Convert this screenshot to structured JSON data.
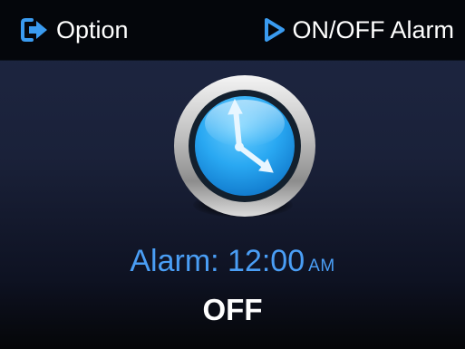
{
  "topbar": {
    "option_label": "Option",
    "option_icon": "exit-arrow-icon",
    "alarm_toggle_label": "ON/OFF Alarm",
    "alarm_toggle_icon": "play-triangle-icon",
    "icon_color": "#3a9bf0"
  },
  "clock": {
    "icon": "clock-icon",
    "face_color": "#29a8f2"
  },
  "alarm": {
    "label": "Alarm:",
    "time": "12:00",
    "period": "AM",
    "status": "OFF",
    "text_color": "#4a9ef5"
  }
}
